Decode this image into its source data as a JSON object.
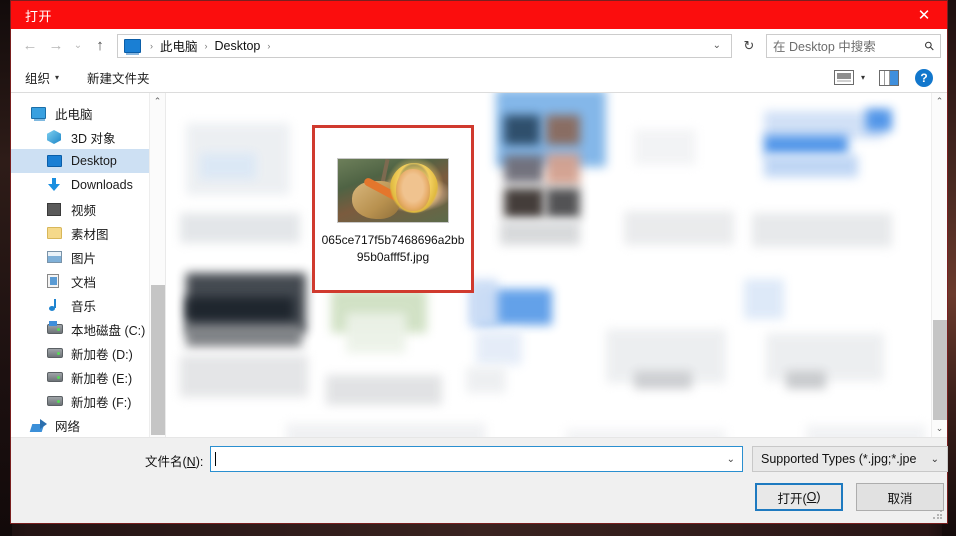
{
  "window": {
    "title": "打开",
    "close_label": "✕",
    "titlebar_color": "#fb0d0d"
  },
  "nav": {
    "back_icon": "←",
    "forward_icon": "→",
    "recent_icon": "⌄",
    "up_icon": "↑",
    "refresh_icon": "↻",
    "address_chevron": "⌄",
    "breadcrumbs": [
      "此电脑",
      "Desktop"
    ],
    "crumb_sep": "›"
  },
  "search": {
    "placeholder": "在 Desktop 中搜索",
    "icon": "search-icon"
  },
  "commandbar": {
    "organize": "组织",
    "organize_caret": "▾",
    "new_folder": "新建文件夹",
    "view_icon": "view-icon",
    "view_caret": "▾",
    "preview_pane_icon": "preview-pane-icon",
    "help_icon": "?"
  },
  "sidebar": {
    "items": [
      {
        "label": "此电脑",
        "icon": "computer-icon",
        "indent": false,
        "selected": false
      },
      {
        "label": "3D 对象",
        "icon": "3d-objects-icon",
        "indent": true,
        "selected": false
      },
      {
        "label": "Desktop",
        "icon": "desktop-icon",
        "indent": true,
        "selected": true
      },
      {
        "label": "Downloads",
        "icon": "downloads-icon",
        "indent": true,
        "selected": false
      },
      {
        "label": "视频",
        "icon": "videos-icon",
        "indent": true,
        "selected": false
      },
      {
        "label": "素材图",
        "icon": "folder-icon",
        "indent": true,
        "selected": false
      },
      {
        "label": "图片",
        "icon": "pictures-icon",
        "indent": true,
        "selected": false
      },
      {
        "label": "文档",
        "icon": "documents-icon",
        "indent": true,
        "selected": false
      },
      {
        "label": "音乐",
        "icon": "music-icon",
        "indent": true,
        "selected": false
      },
      {
        "label": "本地磁盘 (C:)",
        "icon": "system-drive-icon",
        "indent": true,
        "selected": false
      },
      {
        "label": "新加卷 (D:)",
        "icon": "drive-icon",
        "indent": true,
        "selected": false
      },
      {
        "label": "新加卷 (E:)",
        "icon": "drive-icon",
        "indent": true,
        "selected": false
      },
      {
        "label": "新加卷 (F:)",
        "icon": "drive-icon",
        "indent": true,
        "selected": false
      },
      {
        "label": "网络",
        "icon": "network-icon",
        "indent": false,
        "selected": false
      }
    ],
    "scroll_up_icon": "⌃",
    "scroll_down_icon": "⌄"
  },
  "content": {
    "selected_file": {
      "name": "065ce717f5b7468696a2bb95b0afff5f.jpg",
      "highlight_color": "#d03a2e"
    },
    "scroll_up_icon": "⌃",
    "scroll_down_icon": "⌄"
  },
  "footer": {
    "filename_label_prefix": "文件名(",
    "filename_label_key": "N",
    "filename_label_suffix": "):",
    "filename_value": "",
    "filename_chevron": "⌄",
    "filter_value": "Supported Types (*.jpg;*.jpe",
    "filter_chevron": "⌄",
    "open_prefix": "打开(",
    "open_key": "O",
    "open_suffix": ")",
    "cancel_label": "取消"
  }
}
